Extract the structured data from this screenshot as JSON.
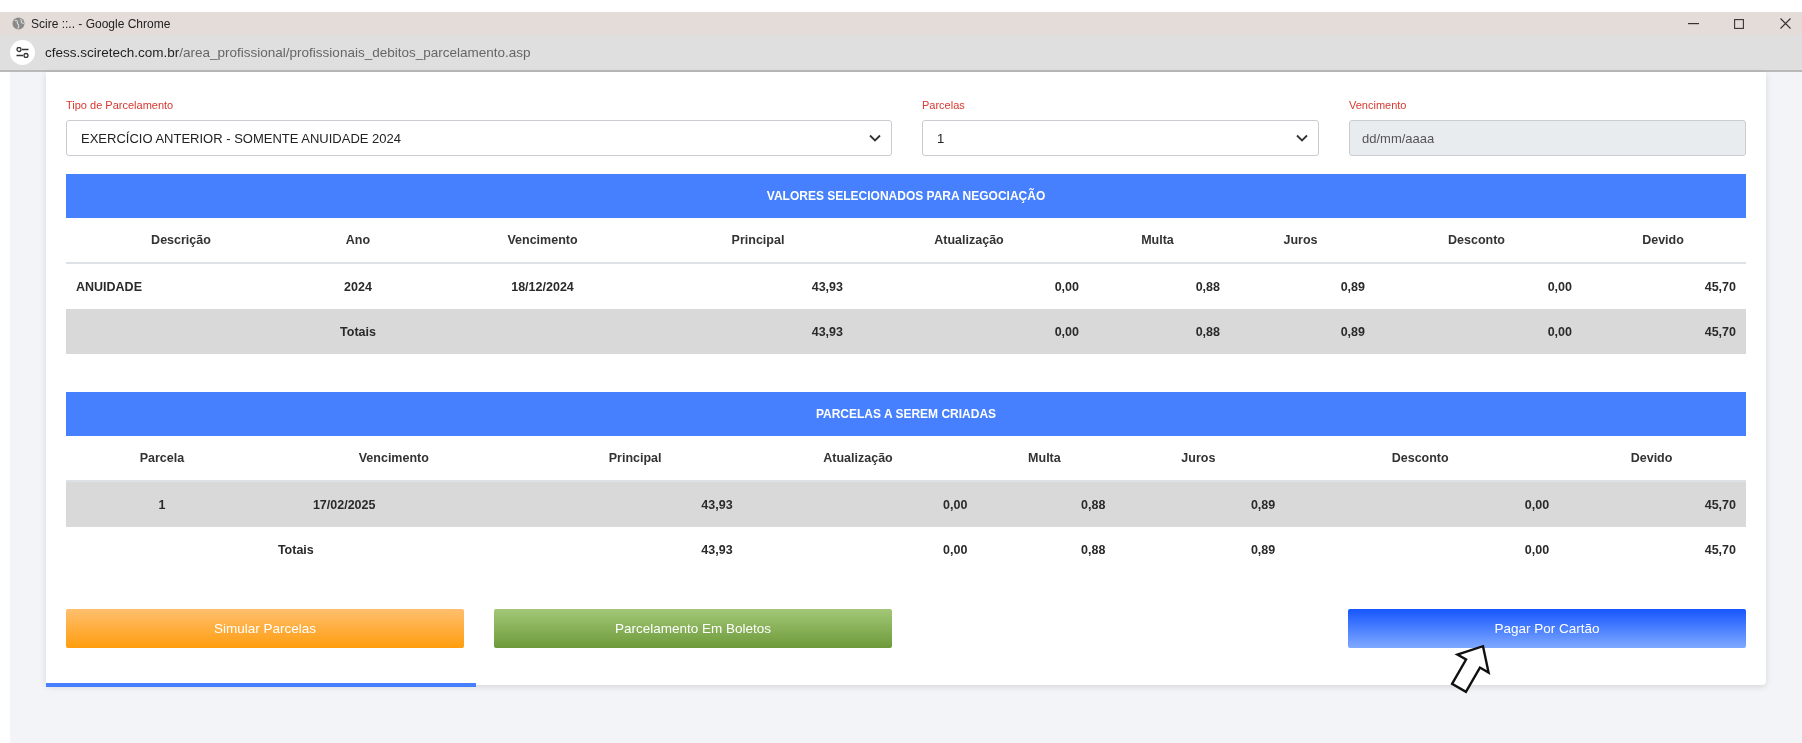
{
  "browser": {
    "title": "Scire ::.. - Google Chrome",
    "url_host": "cfess.sciretech.com.br",
    "url_path": "/area_profissional/profissionais_debitos_parcelamento.asp"
  },
  "filters": [
    {
      "label": "Tipo de Parcelamento",
      "kind": "select",
      "value": "EXERCÍCIO ANTERIOR - SOMENTE ANUIDADE 2024"
    },
    {
      "label": "Parcelas",
      "kind": "select",
      "value": "1"
    },
    {
      "label": "Vencimento",
      "kind": "date",
      "placeholder": "dd/mm/aaaa",
      "disabled": true
    }
  ],
  "tables": [
    {
      "title": "VALORES SELECIONADOS PARA NEGOCIAÇÃO",
      "columns": [
        "Descrição",
        "Ano",
        "Vencimento",
        "Principal",
        "Atualização",
        "Multa",
        "Juros",
        "Desconto",
        "Devido"
      ],
      "rows": [
        {
          "kind": "item",
          "shaded": false,
          "cells": [
            "ANUIDADE",
            "2024",
            "18/12/2024",
            "43,93",
            "0,00",
            "0,88",
            "0,89",
            "0,00",
            "45,70"
          ]
        },
        {
          "kind": "total",
          "shaded": true,
          "cells": [
            null,
            "Totais",
            null,
            "43,93",
            "0,00",
            "0,88",
            "0,89",
            "0,00",
            "45,70"
          ]
        }
      ]
    },
    {
      "title": "PARCELAS A SEREM CRIADAS",
      "columns": [
        "Parcela",
        "Vencimento",
        "Principal",
        "Atualização",
        "Multa",
        "Juros",
        "Desconto",
        "Devido"
      ],
      "rows": [
        {
          "kind": "item",
          "shaded": true,
          "cells": [
            "1",
            "17/02/2025",
            "43,93",
            "0,00",
            "0,88",
            "0,89",
            "0,00",
            "45,70"
          ]
        },
        {
          "kind": "total",
          "shaded": false,
          "cells": [
            null,
            "Totais",
            "43,93",
            "0,00",
            "0,88",
            "0,89",
            "0,00",
            "45,70"
          ]
        }
      ]
    }
  ],
  "buttons": [
    {
      "label": "Simular Parcelas",
      "kind": "warning"
    },
    {
      "label": "Parcelamento Em Boletos",
      "kind": "success"
    },
    {
      "label": "Pagar Por Cartão",
      "kind": "primary"
    }
  ]
}
